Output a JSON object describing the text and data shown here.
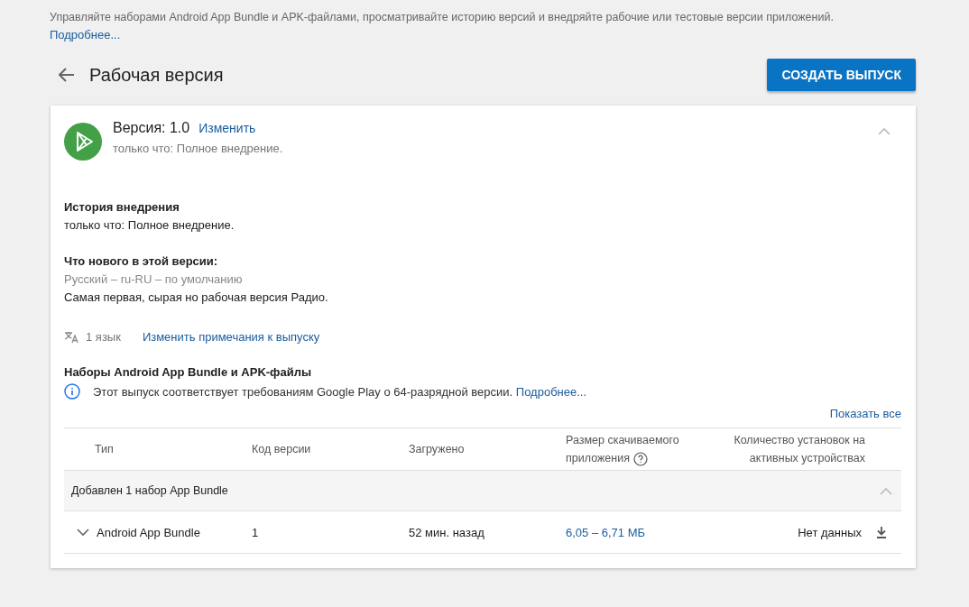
{
  "intro": {
    "text": "Управляйте наборами Android App Bundle и APK-файлами, просматривайте историю версий и внедряйте рабочие или тестовые версии приложений.",
    "link": "Подробнее..."
  },
  "header": {
    "title": "Рабочая версия",
    "button": "СОЗДАТЬ ВЫПУСК"
  },
  "release": {
    "expanded": true,
    "version": "Версия: 1.0",
    "edit_link": "Изменить",
    "status": "только что: Полное внедрение.",
    "history": {
      "title": "История внедрения",
      "text": "только что: Полное внедрение."
    },
    "whats_new": {
      "title": "Что нового в этой версии:",
      "locale": "Русский – ru-RU – по умолчанию",
      "note": "Самая первая, сырая но рабочая версия Радио."
    },
    "languages": "1 язык",
    "edit_notes": "Изменить примечания к выпуску"
  },
  "bundles": {
    "title": "Наборы Android App Bundle и APK-файлы",
    "info": "Этот выпуск соответствует требованиям Google Play о 64-разрядной версии.",
    "info_link": "Подробнее...",
    "show_all": "Показать все",
    "columns": [
      {
        "label": "Тип",
        "help": false
      },
      {
        "label": "Код версии",
        "help": false
      },
      {
        "label": "Загружено",
        "help": false
      },
      {
        "label": "Размер скачиваемого приложения",
        "help": true
      },
      {
        "label": "Количество установок на активных устройствах",
        "help": false
      }
    ],
    "groups": [
      {
        "label": "Добавлен 1 набор App Bundle",
        "expanded": true,
        "rows": [
          {
            "expanded": false,
            "type": "Android App Bundle",
            "code": "1",
            "uploaded": "52 мин. назад",
            "size": "6,05 – 6,71 МБ",
            "installs": "Нет данных"
          }
        ]
      }
    ]
  }
}
